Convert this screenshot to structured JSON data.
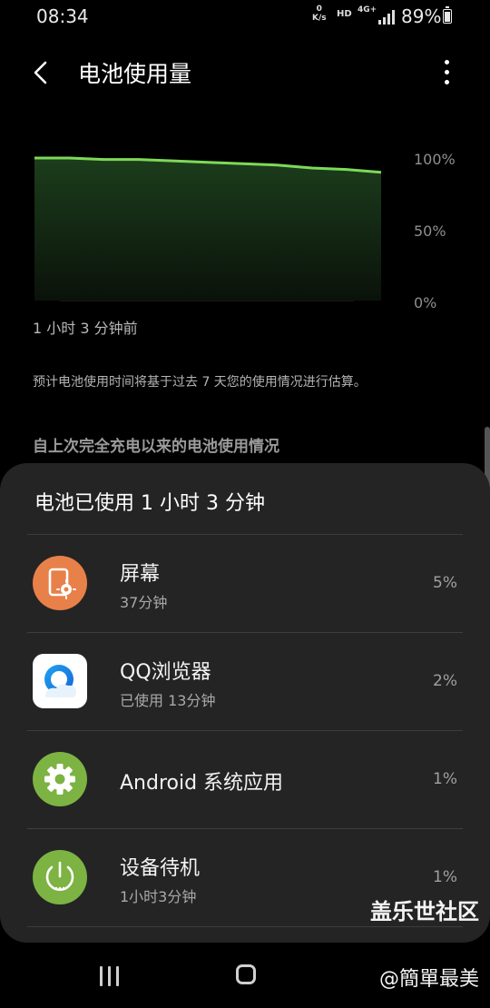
{
  "status_bar": {
    "time": "08:34",
    "net_speed_value": "0",
    "net_speed_unit": "K/s",
    "hd": "HD",
    "network": "4G+",
    "battery_percent": "89%"
  },
  "header": {
    "title": "电池使用量",
    "back_icon": "chevron-left-icon",
    "more_icon": "more-vertical-icon"
  },
  "chart": {
    "y_labels": [
      "100%",
      "50%",
      "0%"
    ],
    "time_label": "1 小时 3 分钟前",
    "line_color": "#7ed957"
  },
  "chart_data": {
    "type": "area",
    "x": [
      0,
      0.1,
      0.2,
      0.3,
      0.4,
      0.5,
      0.6,
      0.7,
      0.8,
      0.9,
      1.0
    ],
    "values": [
      100,
      100,
      99,
      99,
      98,
      97,
      96,
      95,
      93,
      92,
      90
    ],
    "ylim": [
      0,
      100
    ],
    "xlabel": "",
    "ylabel": "",
    "grid": true
  },
  "estimate_note": "预计电池使用时间将基于过去 7 天您的使用情况进行估算。",
  "section_title": "自上次完全充电以来的电池使用情况",
  "sheet": {
    "title": "电池已使用 1 小时 3 分钟",
    "items": [
      {
        "name": "屏幕",
        "sub": "37分钟",
        "pct": "5%",
        "icon": "screen-brightness-icon",
        "icon_bg": "#e8804a"
      },
      {
        "name": "QQ浏览器",
        "sub": "已使用 13分钟",
        "pct": "2%",
        "icon": "qq-browser-icon",
        "icon_bg": "#ffffff"
      },
      {
        "name": "Android 系统应用",
        "sub": "",
        "pct": "1%",
        "icon": "gear-icon",
        "icon_bg": "#7cb342"
      },
      {
        "name": "设备待机",
        "sub": "1小时3分钟",
        "pct": "1%",
        "icon": "power-icon",
        "icon_bg": "#7cb342"
      }
    ]
  },
  "watermark": {
    "line1": "盖乐世社区",
    "line2": "@簡單最美"
  }
}
